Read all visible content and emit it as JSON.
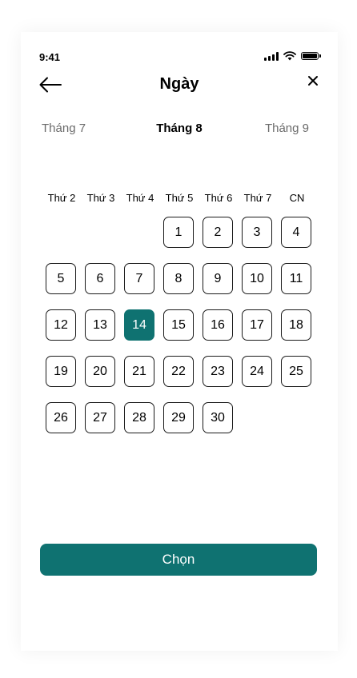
{
  "status_bar": {
    "time": "9:41"
  },
  "header": {
    "title": "Ngày",
    "back_icon": "arrow-left-icon",
    "close_icon": "close-icon"
  },
  "months": {
    "previous": "Tháng 7",
    "current": "Tháng 8",
    "next": "Tháng 9"
  },
  "weekdays": [
    "Thứ 2",
    "Thứ 3",
    "Thứ 4",
    "Thứ 5",
    "Thứ 6",
    "Thứ 7",
    "CN"
  ],
  "calendar": {
    "first_weekday_index": 3,
    "days_in_month": 30,
    "selected_day": 14
  },
  "colors": {
    "accent": "#0f7271",
    "border": "#1a1a1a",
    "muted_text": "#6b6b6b"
  },
  "actions": {
    "choose_label": "Chọn"
  }
}
